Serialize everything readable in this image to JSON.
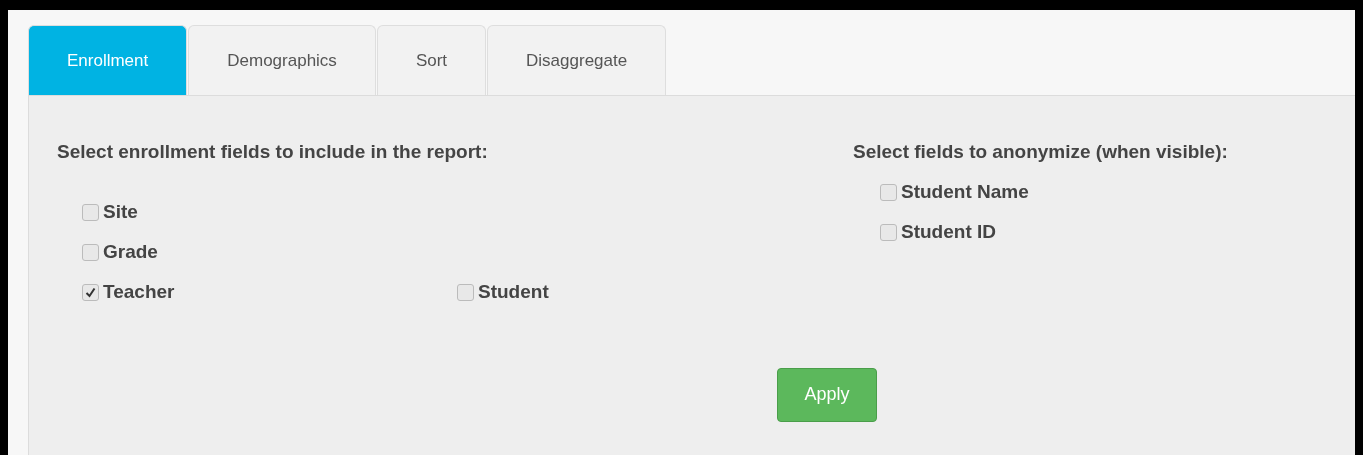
{
  "tabs": [
    {
      "label": "Enrollment",
      "selected": true
    },
    {
      "label": "Demographics",
      "selected": false
    },
    {
      "label": "Sort",
      "selected": false
    },
    {
      "label": "Disaggregate",
      "selected": false
    }
  ],
  "enrollment": {
    "heading": "Select enrollment fields to include in the report:",
    "rows": [
      [
        {
          "label": "Site",
          "checked": false
        }
      ],
      [
        {
          "label": "Grade",
          "checked": false
        }
      ],
      [
        {
          "label": "Teacher",
          "checked": true
        },
        {
          "label": "Student",
          "checked": false
        }
      ]
    ]
  },
  "anonymize": {
    "heading": "Select fields to anonymize (when visible):",
    "items": [
      {
        "label": "Student Name",
        "checked": false
      },
      {
        "label": "Student ID",
        "checked": false
      }
    ]
  },
  "apply_button": "Apply"
}
